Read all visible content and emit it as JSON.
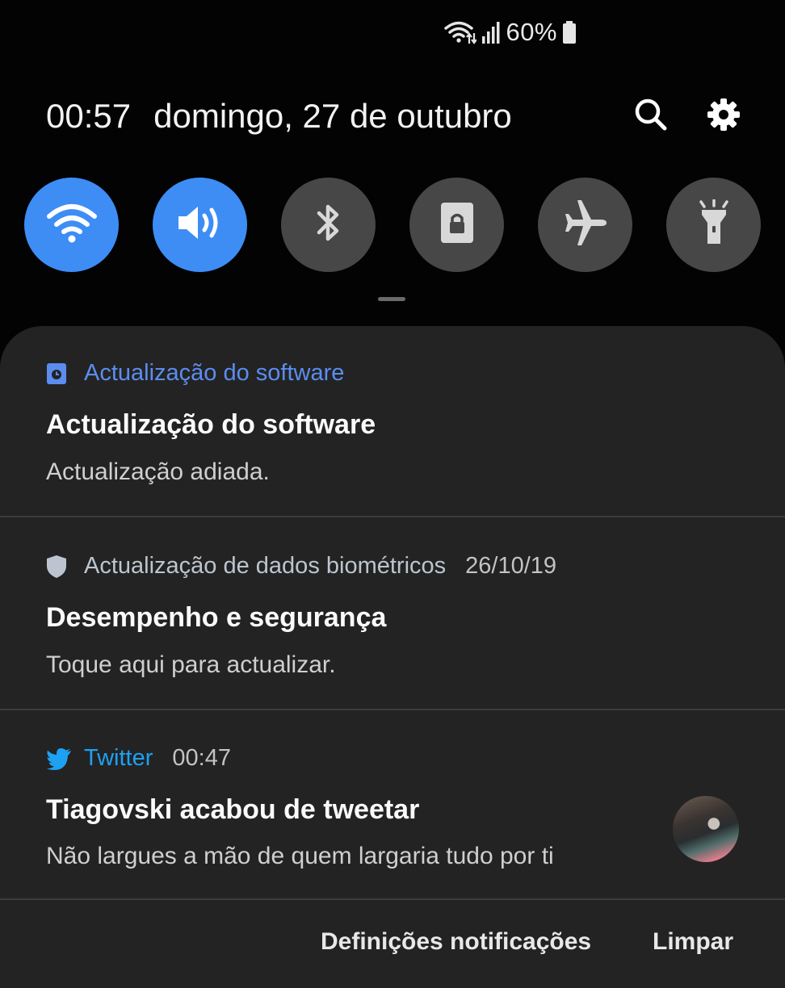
{
  "status_bar": {
    "wifi_icon": "wifi-data-icon",
    "signal_icon": "signal-icon",
    "battery_text": "60%",
    "battery_icon": "battery-icon"
  },
  "header": {
    "time": "00:57",
    "date": "domingo, 27 de outubro",
    "search_icon": "search-icon",
    "settings_icon": "gear-icon"
  },
  "quick_settings": [
    {
      "name": "wifi",
      "icon": "wifi-icon",
      "state": "on"
    },
    {
      "name": "sound",
      "icon": "volume-icon",
      "state": "on"
    },
    {
      "name": "bluetooth",
      "icon": "bluetooth-icon",
      "state": "off"
    },
    {
      "name": "portrait-lock",
      "icon": "portrait-lock-icon",
      "state": "off"
    },
    {
      "name": "airplane",
      "icon": "airplane-icon",
      "state": "off"
    },
    {
      "name": "flashlight",
      "icon": "flashlight-icon",
      "state": "off"
    }
  ],
  "colors": {
    "accent_blue": "#3d8df5",
    "tile_off": "#474747",
    "panel_bg": "#232323",
    "software_app": "#5b8df0",
    "twitter_app": "#1da1f2",
    "biometric_app": "#bcc5cf"
  },
  "notifications": [
    {
      "app_icon": "software-update-icon",
      "app_name": "Actualização do software",
      "time": "",
      "title": "Actualização do software",
      "body": "Actualização adiada."
    },
    {
      "app_icon": "shield-icon",
      "app_name": "Actualização de dados biométricos",
      "time": "26/10/19",
      "title": "Desempenho e segurança",
      "body": "Toque aqui para actualizar."
    },
    {
      "app_icon": "twitter-icon",
      "app_name": "Twitter",
      "time": "00:47",
      "title": "Tiagovski acabou de tweetar",
      "body": "Não largues a mão de quem largaria tudo por ti",
      "avatar": "avatar-image"
    }
  ],
  "footer": {
    "settings_label": "Definições notificações",
    "clear_label": "Limpar"
  }
}
